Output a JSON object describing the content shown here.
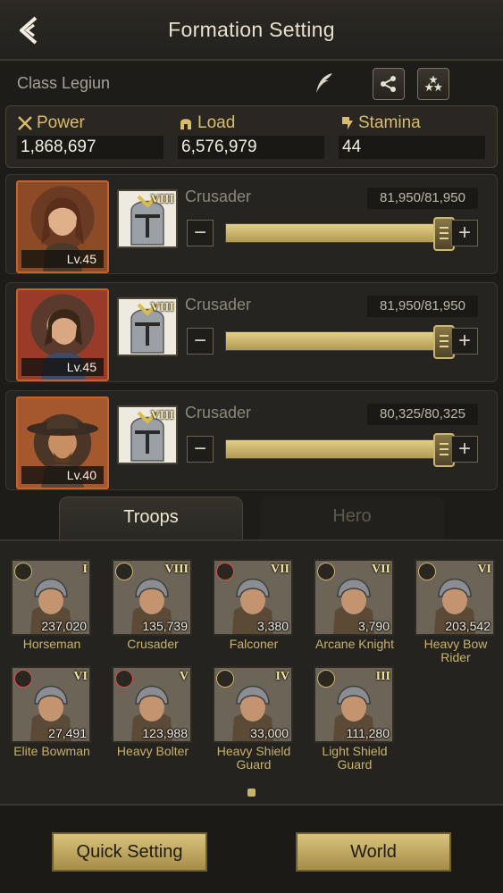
{
  "header": {
    "title": "Formation Setting"
  },
  "formation": {
    "name": "Class Legiun"
  },
  "stats": {
    "power": {
      "label": "Power",
      "value": "1,868,697"
    },
    "load": {
      "label": "Load",
      "value": "6,576,979"
    },
    "stamina": {
      "label": "Stamina",
      "value": "44"
    }
  },
  "heroes": [
    {
      "level": "Lv.45",
      "troop": "Crusader",
      "tier": "VIII",
      "count": "81,950/81,950",
      "fill": 1.0
    },
    {
      "level": "Lv.45",
      "troop": "Crusader",
      "tier": "VIII",
      "count": "81,950/81,950",
      "fill": 1.0
    },
    {
      "level": "Lv.40",
      "troop": "Crusader",
      "tier": "VIII",
      "count": "80,325/80,325",
      "fill": 1.0
    }
  ],
  "tabs": {
    "troops": "Troops",
    "hero": "Hero"
  },
  "troops": [
    {
      "name": "Horseman",
      "tier": "I",
      "count": "237,020",
      "type": "cavalry-icon"
    },
    {
      "name": "Crusader",
      "tier": "VIII",
      "count": "135,739",
      "type": "cavalry-icon"
    },
    {
      "name": "Falconer",
      "tier": "VII",
      "count": "3,380",
      "type": "archer-icon"
    },
    {
      "name": "Arcane Knight",
      "tier": "VII",
      "count": "3,790",
      "type": "cavalry-icon"
    },
    {
      "name": "Heavy Bow Rider",
      "tier": "VI",
      "count": "203,542",
      "type": "cavalry-icon"
    },
    {
      "name": "Elite Bowman",
      "tier": "VI",
      "count": "27,491",
      "type": "archer-icon"
    },
    {
      "name": "Heavy Bolter",
      "tier": "V",
      "count": "123,988",
      "type": "archer-icon"
    },
    {
      "name": "Heavy Shield Guard",
      "tier": "IV",
      "count": "33,000",
      "type": "infantry-icon"
    },
    {
      "name": "Light Shield Guard",
      "tier": "III",
      "count": "111,280",
      "type": "infantry-icon"
    }
  ],
  "footer": {
    "quick_setting": "Quick Setting",
    "world": "World"
  },
  "colors": {
    "accent_gold": "#c9b26a",
    "portrait_border": "#c8612a",
    "background": "#1e1c19"
  }
}
